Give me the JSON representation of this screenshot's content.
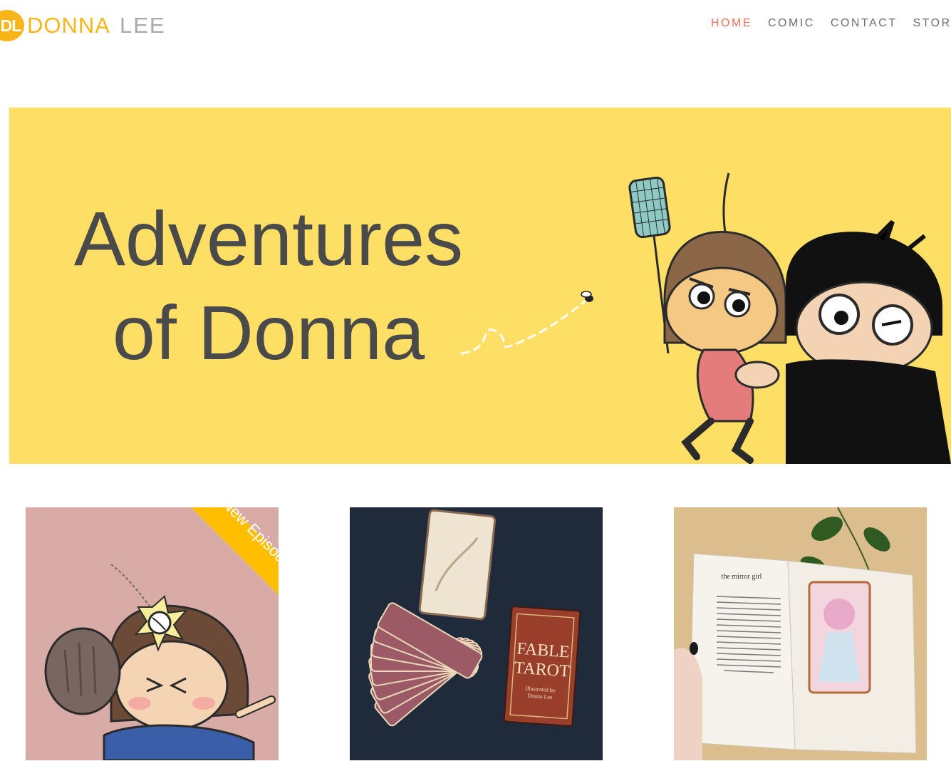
{
  "brand": {
    "initials": "DL",
    "first_name": "DONNA",
    "last_name": "LEE",
    "colors": {
      "accent": "#f8b51a",
      "gray": "#a9a9a9"
    }
  },
  "nav": {
    "items": [
      {
        "label": "HOME",
        "active": true
      },
      {
        "label": "COMIC",
        "active": false
      },
      {
        "label": "CONTACT",
        "active": false
      },
      {
        "label": "STOR",
        "active": false
      }
    ],
    "active_color": "#e8735a"
  },
  "hero": {
    "title_line1": "Adventures",
    "title_line2": "of Donna",
    "background": "#fedf66"
  },
  "cards": [
    {
      "ribbon": "New Episode"
    },
    {
      "box_title_1": "FABLE",
      "box_title_2": "TAROT",
      "box_byline_1": "Illustrated by",
      "box_byline_2": "Donna Lee"
    },
    {
      "chapter_title": "the mirror girl"
    }
  ]
}
